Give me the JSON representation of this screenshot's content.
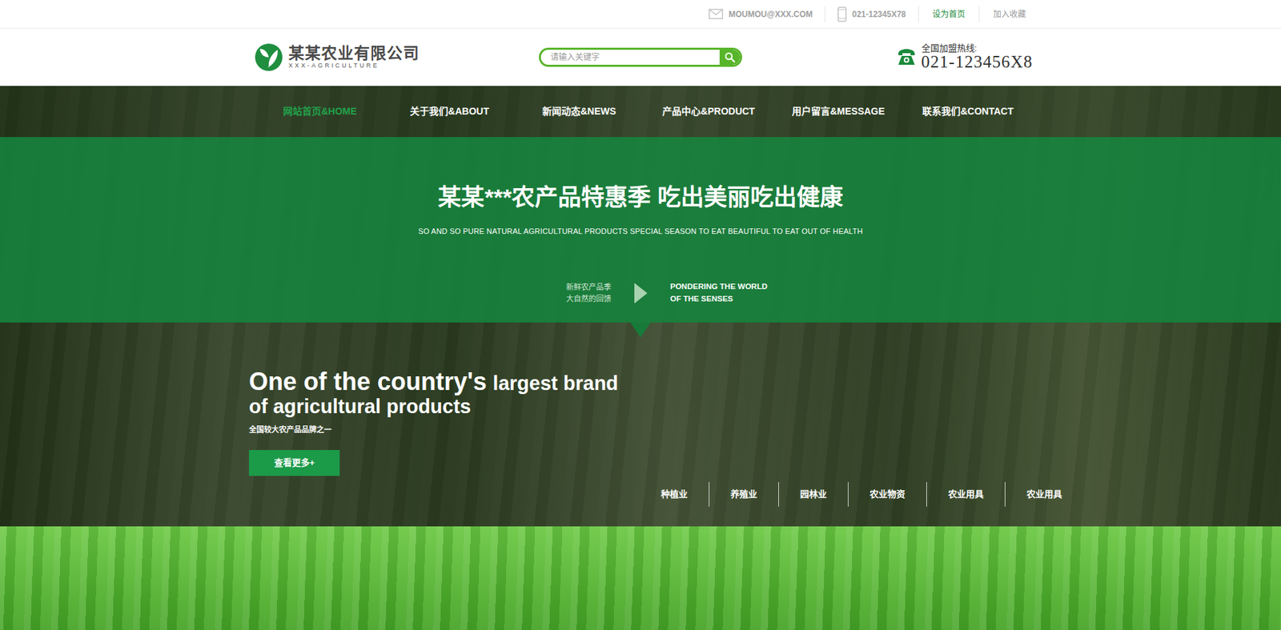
{
  "topbar": {
    "email": "MOUMOU@XXX.COM",
    "phone": "021-12345X78",
    "links": [
      {
        "label": "设为首页",
        "highlighted": true
      },
      {
        "label": "加入收藏",
        "highlighted": false
      }
    ]
  },
  "header": {
    "logo": {
      "title": "某某农业有限公司",
      "subtitle": "XXX-AGRICULTURE"
    },
    "search": {
      "placeholder": "请输入关键字"
    },
    "hotline": {
      "label": "全国加盟热线:",
      "number": "021-123456X8"
    }
  },
  "nav": [
    {
      "label": "网站首页&HOME",
      "selected": true
    },
    {
      "label": "关于我们&ABOUT",
      "selected": false
    },
    {
      "label": "新闻动态&NEWS",
      "selected": false
    },
    {
      "label": "产品中心&PRODUCT",
      "selected": false
    },
    {
      "label": "用户留言&MESSAGE",
      "selected": false
    },
    {
      "label": "联系我们&CONTACT",
      "selected": false
    }
  ],
  "banner": {
    "title": "某某***农产品特惠季 吃出美丽吃出健康",
    "subtitle": "SO AND SO PURE NATURAL AGRICULTURAL PRODUCTS SPECIAL SEASON TO EAT BEAUTIFUL TO EAT OUT OF HEALTH",
    "left_lines": [
      "新鲜农产品季",
      "大自然的回馈"
    ],
    "right_lines": [
      "PONDERING THE WORLD",
      "OF THE SENSES"
    ]
  },
  "hero": {
    "heading": {
      "big": "One of the country's",
      "small": "largest brand",
      "line2": "of agricultural products"
    },
    "tagline": "全国较大农产品品牌之一",
    "button": "查看更多+",
    "categories": [
      "种植业",
      "养殖业",
      "园林业",
      "农业物资",
      "农业用具",
      "农业用具"
    ]
  }
}
